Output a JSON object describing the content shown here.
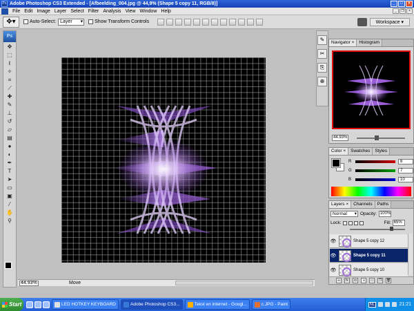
{
  "window": {
    "title": "Adobe Photoshop CS3 Extended - [Afbeelding_004.jpg @ 44,9% (Shape 5 copy 11, RGB/8)]"
  },
  "menu": [
    "File",
    "Edit",
    "Image",
    "Layer",
    "Select",
    "Filter",
    "Analysis",
    "View",
    "Window",
    "Help"
  ],
  "options": {
    "auto_select_label": "Auto-Select:",
    "auto_select_value": "Layer",
    "transform_label": "Show Transform Controls",
    "workspace_label": "Workspace ▾"
  },
  "toolbox": {
    "logo": "Ps"
  },
  "status": {
    "zoom": "44.93%",
    "info": "Move"
  },
  "navigator": {
    "tabs": [
      "Navigator ×",
      "Histogram"
    ],
    "zoom": "44.93%"
  },
  "color_panel": {
    "tabs": [
      "Color ×",
      "Swatches",
      "Styles"
    ],
    "r_label": "R",
    "r_value": "6",
    "r_color": "#d00000",
    "g_label": "G",
    "g_value": "7",
    "g_color": "#00a000",
    "b_label": "B",
    "b_value": "10",
    "b_color": "#0000d0"
  },
  "layers_panel": {
    "tabs": [
      "Layers ×",
      "Channels",
      "Paths"
    ],
    "blend_mode": "Normal",
    "opacity_label": "Opacity:",
    "opacity_value": "100%",
    "lock_label": "Lock:",
    "fill_label": "Fill:",
    "fill_value": "65%",
    "layers": [
      {
        "name": "Shape 5 copy 12",
        "selected": false
      },
      {
        "name": "Shape 5 copy 11",
        "selected": true
      },
      {
        "name": "Shape 5 copy 10",
        "selected": false
      }
    ],
    "footer_icons": [
      "link-icon",
      "fx-icon",
      "mask-icon",
      "adjustment-icon",
      "folder-icon",
      "new-layer-icon",
      "trash-icon"
    ]
  },
  "taskbar": {
    "start_label": "Start",
    "tasks": [
      {
        "label": "LED HOTKEY KEYBOARD",
        "active": false,
        "icon_color": "#e0e0e0"
      },
      {
        "label": "Adobe Photoshop CS3...",
        "active": true,
        "icon_color": "#3a78d8"
      },
      {
        "label": "Tekst en internet - Googl...",
        "active": false,
        "icon_color": "#ffb000"
      },
      {
        "label": "c.JPG - Paint",
        "active": false,
        "icon_color": "#e07030"
      }
    ],
    "lang": "NL",
    "clock": "21:21"
  },
  "colors": {
    "accent_purple": "#a070d8",
    "title_blue": "#1e4fbd"
  }
}
